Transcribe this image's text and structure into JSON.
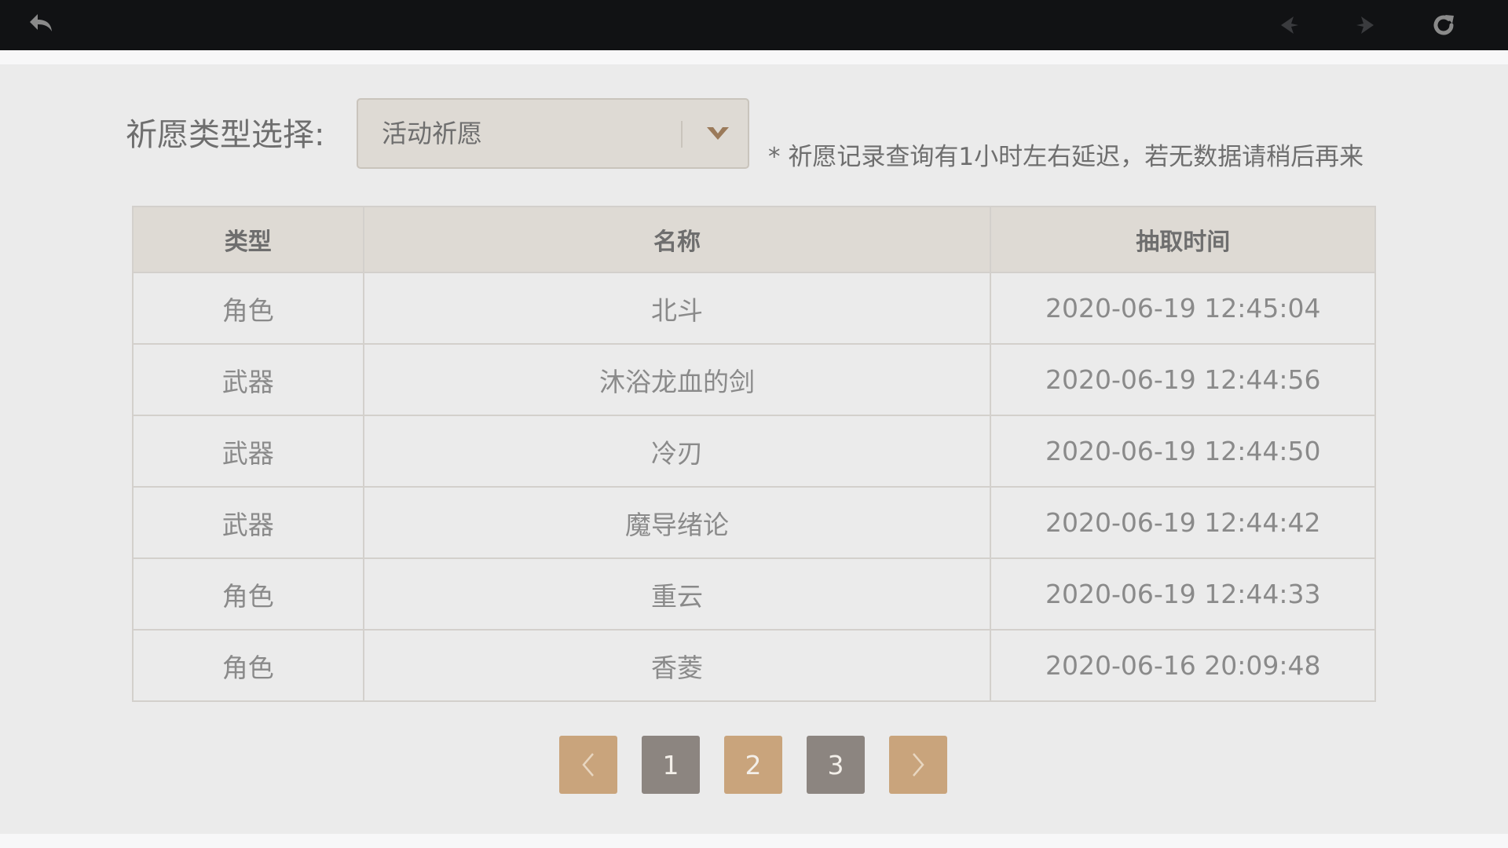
{
  "colors": {
    "topbar": "#111214",
    "background": "#ebebeb",
    "table_header": "#dedad4",
    "accent_tan": "#c9a47c",
    "accent_grey": "#8c8580",
    "chevron": "#9b7a5a"
  },
  "nav": {
    "back_icon": "undo-arrow-icon",
    "prev_icon": "triangle-left-icon",
    "next_icon": "triangle-right-icon",
    "reload_icon": "reload-icon"
  },
  "filter": {
    "label": "祈愿类型选择:",
    "selected": "活动祈愿"
  },
  "notice": "* 祈愿记录查询有1小时左右延迟，若无数据请稍后再来",
  "table": {
    "headers": [
      "类型",
      "名称",
      "抽取时间"
    ],
    "rows": [
      {
        "type": "角色",
        "name": "北斗",
        "time": "2020-06-19 12:45:04"
      },
      {
        "type": "武器",
        "name": "沐浴龙血的剑",
        "time": "2020-06-19 12:44:56"
      },
      {
        "type": "武器",
        "name": "冷刃",
        "time": "2020-06-19 12:44:50"
      },
      {
        "type": "武器",
        "name": "魔导绪论",
        "time": "2020-06-19 12:44:42"
      },
      {
        "type": "角色",
        "name": "重云",
        "time": "2020-06-19 12:44:33"
      },
      {
        "type": "角色",
        "name": "香菱",
        "time": "2020-06-16 20:09:48"
      }
    ]
  },
  "pagination": {
    "pages": [
      "1",
      "2",
      "3"
    ],
    "prev_icon": "chevron-left-icon",
    "next_icon": "chevron-right-icon"
  }
}
